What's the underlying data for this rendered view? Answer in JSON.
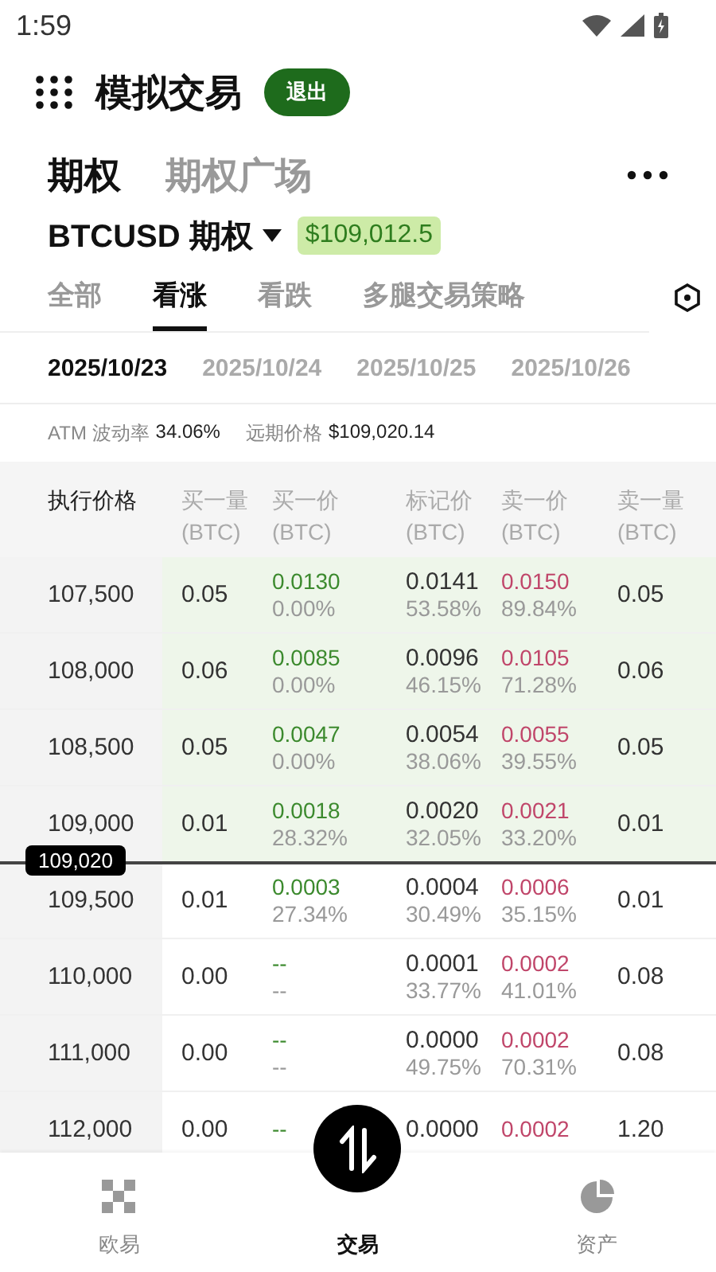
{
  "status_bar": {
    "time": "1:59"
  },
  "header": {
    "title": "模拟交易",
    "exit_button": "退出"
  },
  "page_tabs": [
    {
      "label": "期权",
      "selected": true
    },
    {
      "label": "期权广场",
      "selected": false
    }
  ],
  "instrument": {
    "symbol": "BTCUSD 期权",
    "price": "$109,012.5"
  },
  "filter_tabs": [
    {
      "label": "全部",
      "selected": false
    },
    {
      "label": "看涨",
      "selected": true
    },
    {
      "label": "看跌",
      "selected": false
    },
    {
      "label": "多腿交易策略",
      "selected": false
    }
  ],
  "dates": [
    {
      "label": "2025/10/23",
      "selected": true
    },
    {
      "label": "2025/10/24",
      "selected": false
    },
    {
      "label": "2025/10/25",
      "selected": false
    },
    {
      "label": "2025/10/26",
      "selected": false
    }
  ],
  "summary": {
    "iv_label": "ATM 波动率",
    "iv_value": "34.06%",
    "forward_label": "远期价格",
    "forward_value": "$109,020.14"
  },
  "table": {
    "columns": [
      {
        "label": "执行价格"
      },
      {
        "label": "买一量",
        "unit": "(BTC)"
      },
      {
        "label": "买一价",
        "unit": "(BTC)"
      },
      {
        "label": "标记价",
        "unit": "(BTC)"
      },
      {
        "label": "卖一价",
        "unit": "(BTC)"
      },
      {
        "label": "卖一量",
        "unit": "(BTC)"
      }
    ],
    "rows": [
      {
        "strike": "107,500",
        "in_the_money": true,
        "bid_size": "0.05",
        "bid": "0.0130",
        "bid_iv": "0.00%",
        "mark": "0.0141",
        "mark_iv": "53.58%",
        "ask": "0.0150",
        "ask_iv": "89.84%",
        "ask_size": "0.05"
      },
      {
        "strike": "108,000",
        "in_the_money": true,
        "bid_size": "0.06",
        "bid": "0.0085",
        "bid_iv": "0.00%",
        "mark": "0.0096",
        "mark_iv": "46.15%",
        "ask": "0.0105",
        "ask_iv": "71.28%",
        "ask_size": "0.06"
      },
      {
        "strike": "108,500",
        "in_the_money": true,
        "bid_size": "0.05",
        "bid": "0.0047",
        "bid_iv": "0.00%",
        "mark": "0.0054",
        "mark_iv": "38.06%",
        "ask": "0.0055",
        "ask_iv": "39.55%",
        "ask_size": "0.05"
      },
      {
        "strike": "109,000",
        "in_the_money": true,
        "bid_size": "0.01",
        "bid": "0.0018",
        "bid_iv": "28.32%",
        "mark": "0.0020",
        "mark_iv": "32.05%",
        "ask": "0.0021",
        "ask_iv": "33.20%",
        "ask_size": "0.01"
      },
      {
        "strike": "109,500",
        "in_the_money": false,
        "bid_size": "0.01",
        "bid": "0.0003",
        "bid_iv": "27.34%",
        "mark": "0.0004",
        "mark_iv": "30.49%",
        "ask": "0.0006",
        "ask_iv": "35.15%",
        "ask_size": "0.01"
      },
      {
        "strike": "110,000",
        "in_the_money": false,
        "bid_size": "0.00",
        "bid": "--",
        "bid_iv": "--",
        "mark": "0.0001",
        "mark_iv": "33.77%",
        "ask": "0.0002",
        "ask_iv": "41.01%",
        "ask_size": "0.08"
      },
      {
        "strike": "111,000",
        "in_the_money": false,
        "bid_size": "0.00",
        "bid": "--",
        "bid_iv": "--",
        "mark": "0.0000",
        "mark_iv": "49.75%",
        "ask": "0.0002",
        "ask_iv": "70.31%",
        "ask_size": "0.08"
      },
      {
        "strike": "112,000",
        "in_the_money": false,
        "bid_size": "0.00",
        "bid": "--",
        "mark": "0.0000",
        "ask": "0.0002",
        "ask_size": "1.20"
      }
    ],
    "current_price": "109,020"
  },
  "bottom_nav": [
    {
      "label": "欧易",
      "kind": "tab",
      "selected": false
    },
    {
      "label": "交易",
      "kind": "center",
      "selected": true
    },
    {
      "label": "资产",
      "kind": "assets",
      "selected": false
    }
  ]
}
